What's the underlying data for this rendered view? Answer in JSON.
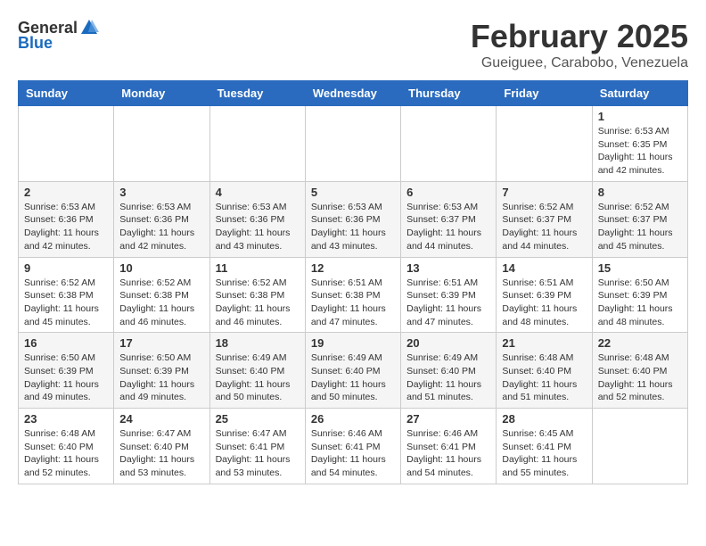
{
  "header": {
    "logo_general": "General",
    "logo_blue": "Blue",
    "month_title": "February 2025",
    "subtitle": "Gueiguee, Carabobo, Venezuela"
  },
  "weekdays": [
    "Sunday",
    "Monday",
    "Tuesday",
    "Wednesday",
    "Thursday",
    "Friday",
    "Saturday"
  ],
  "weeks": [
    [
      {
        "day": "",
        "info": ""
      },
      {
        "day": "",
        "info": ""
      },
      {
        "day": "",
        "info": ""
      },
      {
        "day": "",
        "info": ""
      },
      {
        "day": "",
        "info": ""
      },
      {
        "day": "",
        "info": ""
      },
      {
        "day": "1",
        "info": "Sunrise: 6:53 AM\nSunset: 6:35 PM\nDaylight: 11 hours and 42 minutes."
      }
    ],
    [
      {
        "day": "2",
        "info": "Sunrise: 6:53 AM\nSunset: 6:36 PM\nDaylight: 11 hours and 42 minutes."
      },
      {
        "day": "3",
        "info": "Sunrise: 6:53 AM\nSunset: 6:36 PM\nDaylight: 11 hours and 42 minutes."
      },
      {
        "day": "4",
        "info": "Sunrise: 6:53 AM\nSunset: 6:36 PM\nDaylight: 11 hours and 43 minutes."
      },
      {
        "day": "5",
        "info": "Sunrise: 6:53 AM\nSunset: 6:36 PM\nDaylight: 11 hours and 43 minutes."
      },
      {
        "day": "6",
        "info": "Sunrise: 6:53 AM\nSunset: 6:37 PM\nDaylight: 11 hours and 44 minutes."
      },
      {
        "day": "7",
        "info": "Sunrise: 6:52 AM\nSunset: 6:37 PM\nDaylight: 11 hours and 44 minutes."
      },
      {
        "day": "8",
        "info": "Sunrise: 6:52 AM\nSunset: 6:37 PM\nDaylight: 11 hours and 45 minutes."
      }
    ],
    [
      {
        "day": "9",
        "info": "Sunrise: 6:52 AM\nSunset: 6:38 PM\nDaylight: 11 hours and 45 minutes."
      },
      {
        "day": "10",
        "info": "Sunrise: 6:52 AM\nSunset: 6:38 PM\nDaylight: 11 hours and 46 minutes."
      },
      {
        "day": "11",
        "info": "Sunrise: 6:52 AM\nSunset: 6:38 PM\nDaylight: 11 hours and 46 minutes."
      },
      {
        "day": "12",
        "info": "Sunrise: 6:51 AM\nSunset: 6:38 PM\nDaylight: 11 hours and 47 minutes."
      },
      {
        "day": "13",
        "info": "Sunrise: 6:51 AM\nSunset: 6:39 PM\nDaylight: 11 hours and 47 minutes."
      },
      {
        "day": "14",
        "info": "Sunrise: 6:51 AM\nSunset: 6:39 PM\nDaylight: 11 hours and 48 minutes."
      },
      {
        "day": "15",
        "info": "Sunrise: 6:50 AM\nSunset: 6:39 PM\nDaylight: 11 hours and 48 minutes."
      }
    ],
    [
      {
        "day": "16",
        "info": "Sunrise: 6:50 AM\nSunset: 6:39 PM\nDaylight: 11 hours and 49 minutes."
      },
      {
        "day": "17",
        "info": "Sunrise: 6:50 AM\nSunset: 6:39 PM\nDaylight: 11 hours and 49 minutes."
      },
      {
        "day": "18",
        "info": "Sunrise: 6:49 AM\nSunset: 6:40 PM\nDaylight: 11 hours and 50 minutes."
      },
      {
        "day": "19",
        "info": "Sunrise: 6:49 AM\nSunset: 6:40 PM\nDaylight: 11 hours and 50 minutes."
      },
      {
        "day": "20",
        "info": "Sunrise: 6:49 AM\nSunset: 6:40 PM\nDaylight: 11 hours and 51 minutes."
      },
      {
        "day": "21",
        "info": "Sunrise: 6:48 AM\nSunset: 6:40 PM\nDaylight: 11 hours and 51 minutes."
      },
      {
        "day": "22",
        "info": "Sunrise: 6:48 AM\nSunset: 6:40 PM\nDaylight: 11 hours and 52 minutes."
      }
    ],
    [
      {
        "day": "23",
        "info": "Sunrise: 6:48 AM\nSunset: 6:40 PM\nDaylight: 11 hours and 52 minutes."
      },
      {
        "day": "24",
        "info": "Sunrise: 6:47 AM\nSunset: 6:40 PM\nDaylight: 11 hours and 53 minutes."
      },
      {
        "day": "25",
        "info": "Sunrise: 6:47 AM\nSunset: 6:41 PM\nDaylight: 11 hours and 53 minutes."
      },
      {
        "day": "26",
        "info": "Sunrise: 6:46 AM\nSunset: 6:41 PM\nDaylight: 11 hours and 54 minutes."
      },
      {
        "day": "27",
        "info": "Sunrise: 6:46 AM\nSunset: 6:41 PM\nDaylight: 11 hours and 54 minutes."
      },
      {
        "day": "28",
        "info": "Sunrise: 6:45 AM\nSunset: 6:41 PM\nDaylight: 11 hours and 55 minutes."
      },
      {
        "day": "",
        "info": ""
      }
    ]
  ]
}
